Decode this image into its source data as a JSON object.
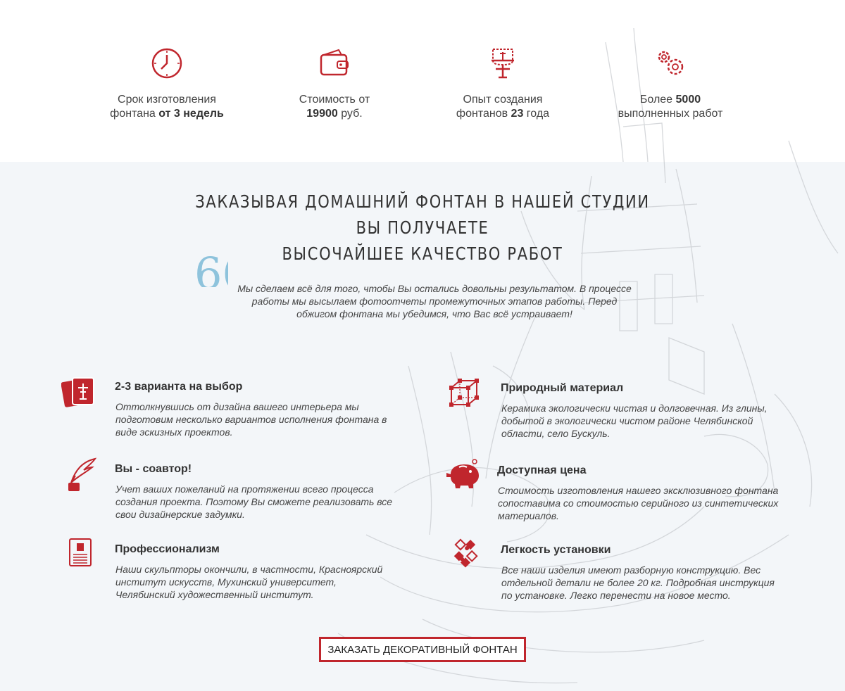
{
  "colors": {
    "accent": "#c0262d",
    "quote": "#8ec3dc",
    "section_bg": "#f3f6f9"
  },
  "stats": [
    {
      "icon": "clock-icon",
      "line1": "Срок изготовления",
      "pre": "фонтана ",
      "bold": "от 3 недель",
      "post": ""
    },
    {
      "icon": "wallet-icon",
      "line1": "Стоимость от",
      "pre": "",
      "bold": "19900",
      "post": " руб."
    },
    {
      "icon": "fountain-icon",
      "line1": "Опыт создания",
      "pre": "фонтанов ",
      "bold": "23",
      "post": " года"
    },
    {
      "icon": "gears-icon",
      "line1_pre": "Более ",
      "line1_bold": "5000",
      "line2": "выполненных работ"
    }
  ],
  "heading": {
    "line1": "ЗАКАЗЫВАЯ ДОМАШНИЙ ФОНТАН В НАШЕЙ СТУДИИ ВЫ ПОЛУЧАЕТЕ",
    "line2": "ВЫСОЧАЙШЕЕ КАЧЕСТВО РАБОТ"
  },
  "quote": "Мы сделаем всё для того, чтобы Вы остались довольны результатом. В процессе работы мы высылаем фотоотчеты промежуточных этапов работы. Перед обжигом фонтана мы убедимся, что Вас всё устраивает!",
  "features": [
    {
      "icon": "cards-icon",
      "title": "2-3 варианта на выбор",
      "desc": "Оттолкнувшись от дизайна вашего интерьера мы подготовим несколько вариантов исполнения фонтана в виде эскизных проектов."
    },
    {
      "icon": "quill-icon",
      "title": "Вы - соавтор!",
      "desc": "Учет ваших пожеланий на протяжении всего процесса создания проекта. Поэтому Вы сможете реализовать все свои дизайнерские задумки."
    },
    {
      "icon": "certificate-icon",
      "title": "Профессионализм",
      "desc": "Наши скульпторы окончили, в частности, Красноярский институт искусств, Мухинский университет, Челябинский художественный институт."
    },
    {
      "icon": "cube-icon",
      "title": "Природный материал",
      "desc": "Керамика экологически чистая и долговечная. Из глины, добытой в экологически чистом районе Челябинской области, село Бускуль."
    },
    {
      "icon": "piggy-bank-icon",
      "title": "Доступная цена",
      "desc": "Стоимость изготовления нашего эксклюзивного фонтана сопоставима со стоимостью серийного из синтетических материалов."
    },
    {
      "icon": "puzzle-icon",
      "title": "Легкость установки",
      "desc": "Все наши изделия имеют разборную конструкцию. Вес отдельной детали не более 20 кг. Подробная инструкция по установке. Легко перенести на новое место."
    }
  ],
  "cta_label": "ЗАКАЗАТЬ ДЕКОРАТИВНЫЙ ФОНТАН"
}
